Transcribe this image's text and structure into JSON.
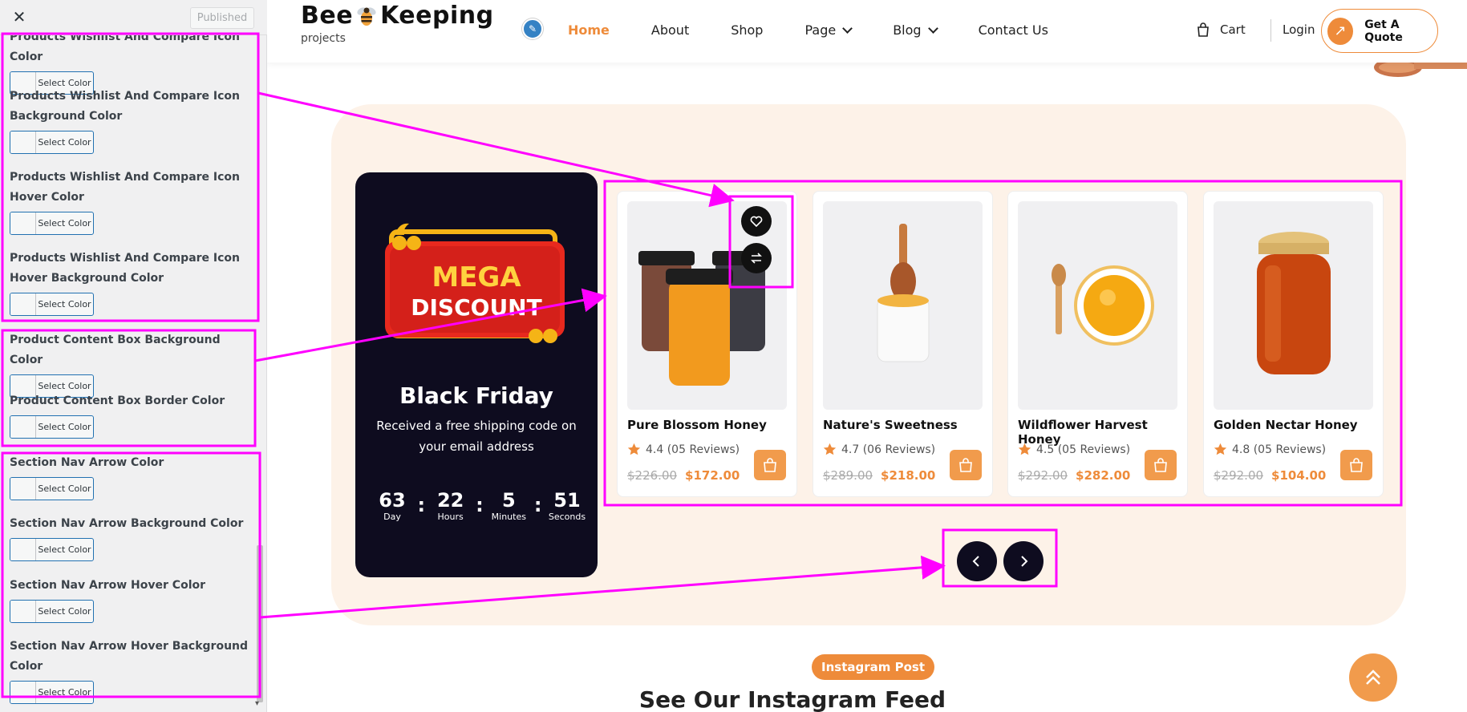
{
  "customizer": {
    "close_label": "✕",
    "published_label": "Published",
    "select_color_label": "Select Color",
    "fields": [
      "Products Wishlist And Compare Icon Color",
      "Products Wishlist And Compare Icon Background Color",
      "Products Wishlist And Compare Icon Hover Color",
      "Products Wishlist And Compare Icon Hover Background Color",
      "Product Content Box Background Color",
      "Product Content Box Border Color",
      "Section Nav Arrow Color",
      "Section Nav Arrow Background Color",
      "Section Nav Arrow Hover Color",
      "Section Nav Arrow Hover Background Color"
    ]
  },
  "header": {
    "logo_left": "Bee",
    "logo_right": "Keeping",
    "logo_sub": "projects",
    "nav": [
      "Home",
      "About",
      "Shop",
      "Page",
      "Blog",
      "Contact Us"
    ],
    "cart_label": "Cart",
    "login_label": "Login",
    "quote_label": "Get A Quote"
  },
  "promo": {
    "badge_line1": "MEGA",
    "badge_line2": "DISCOUNT",
    "title": "Black Friday",
    "description": "Received a free shipping code on your email address",
    "countdown": [
      {
        "value": "63",
        "label": "Day"
      },
      {
        "value": "22",
        "label": "Hours"
      },
      {
        "value": "5",
        "label": "Minutes"
      },
      {
        "value": "51",
        "label": "Seconds"
      }
    ]
  },
  "products": [
    {
      "name": "Pure Blossom Honey",
      "rating": "4.4 (05 Reviews)",
      "old_price": "$226.00",
      "new_price": "$172.00"
    },
    {
      "name": "Nature's Sweetness",
      "rating": "4.7 (06 Reviews)",
      "old_price": "$289.00",
      "new_price": "$218.00"
    },
    {
      "name": "Wildflower Harvest Honey",
      "rating": "4.5 (05 Reviews)",
      "old_price": "$292.00",
      "new_price": "$282.00"
    },
    {
      "name": "Golden Nectar Honey",
      "rating": "4.8 (05 Reviews)",
      "old_price": "$292.00",
      "new_price": "$104.00"
    }
  ],
  "instagram": {
    "badge": "Instagram Post",
    "heading": "See Our Instagram Feed"
  },
  "colors": {
    "accent": "#ee8b3a",
    "dark": "#0e0c1f",
    "promo_bg": "#fdf2e8",
    "annotation": "#ff00ff"
  }
}
